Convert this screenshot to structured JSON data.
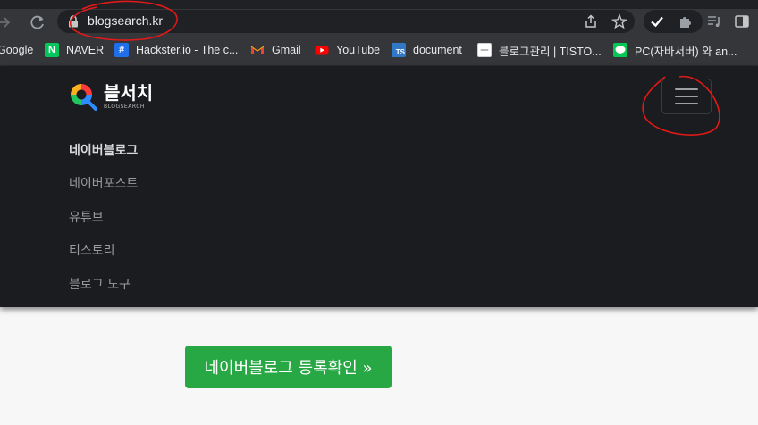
{
  "browser": {
    "url": "blogsearch.kr",
    "bookmarks": [
      {
        "label": "Google",
        "icon": "google-icon"
      },
      {
        "label": "NAVER",
        "icon": "naver-icon",
        "color": "#03c75a"
      },
      {
        "label": "Hackster.io - The c...",
        "icon": "hackster-icon",
        "color": "#1f6feb"
      },
      {
        "label": "Gmail",
        "icon": "gmail-icon"
      },
      {
        "label": "YouTube",
        "icon": "youtube-icon",
        "color": "#ff0000"
      },
      {
        "label": "document",
        "icon": "typescript-icon",
        "color": "#3178c6"
      },
      {
        "label": "블로그관리 | TISTO...",
        "icon": "tistory-icon"
      },
      {
        "label": "PC(자바서버) 와 an...",
        "icon": "line-icon",
        "color": "#06c755"
      }
    ],
    "favicon_text": {
      "naver": "N",
      "hackster": "#",
      "typescript": "TS"
    }
  },
  "site": {
    "logo_title": "블서치",
    "logo_subtitle": "BLOGSEARCH",
    "menu": [
      {
        "label": "네이버블로그",
        "active": true
      },
      {
        "label": "네이버포스트",
        "active": false
      },
      {
        "label": "유튜브",
        "active": false
      },
      {
        "label": "티스토리",
        "active": false
      },
      {
        "label": "블로그 도구",
        "active": false
      }
    ],
    "cta_label": "네이버블로그 등록확인 »",
    "cta_color": "#28a745",
    "nav_bg": "#1b1c1f"
  }
}
